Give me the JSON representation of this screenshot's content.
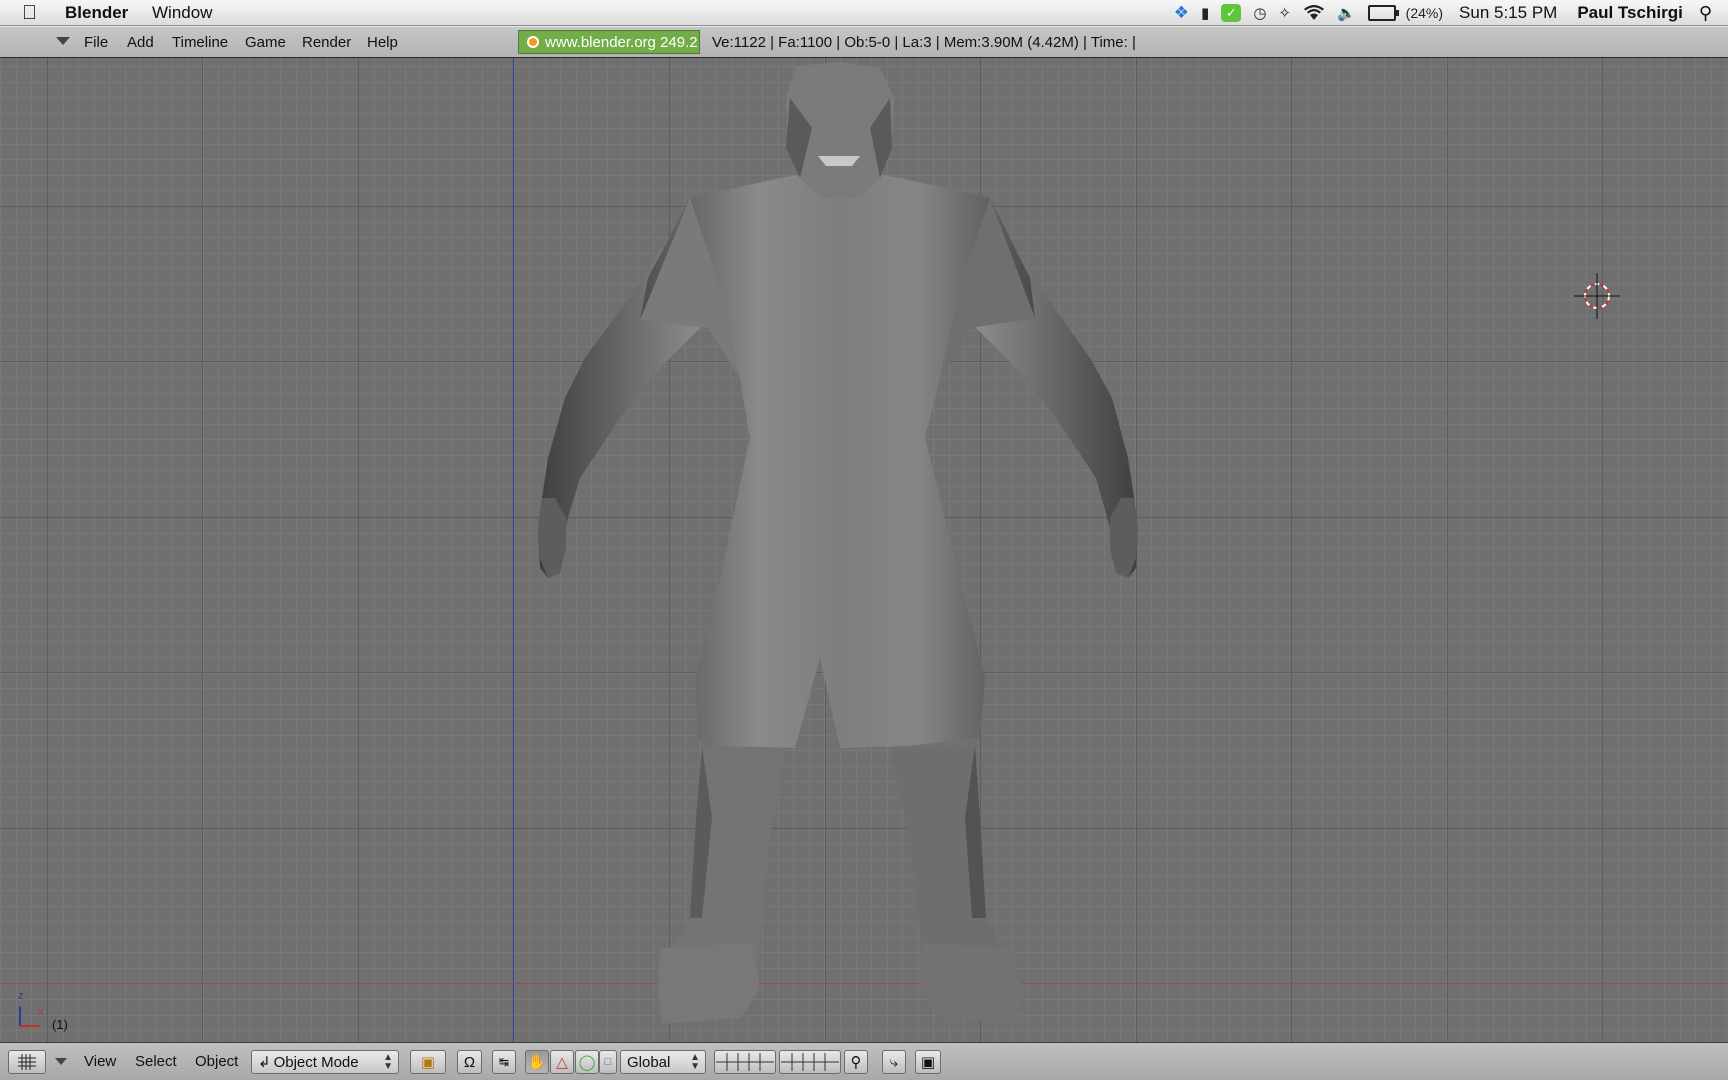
{
  "menubar": {
    "apple_glyph": "",
    "app_name": "Blender",
    "menu_window": "Window",
    "battery_percent": "(24%)",
    "clock": "Sun 5:15 PM",
    "user": "Paul Tschirgi"
  },
  "header": {
    "menus": [
      "File",
      "Add",
      "Timeline",
      "Game",
      "Render",
      "Help"
    ],
    "blender_link": "www.blender.org 249.2",
    "stats": "Ve:1122 | Fa:1100 | Ob:5-0 | La:3  | Mem:3.90M (4.42M)  | Time: |"
  },
  "viewport": {
    "frame_number": "(1)",
    "axis_z": "z",
    "axis_x": "x"
  },
  "toolbar": {
    "view": "View",
    "select": "Select",
    "object": "Object",
    "mode": "Object Mode",
    "orientation": "Global"
  },
  "colors": {
    "viewport_bg": "#707070",
    "x_axis_line": "#a04a4a",
    "y_axis_line": "#2a3e9c",
    "link_green": "#73ad4a"
  }
}
